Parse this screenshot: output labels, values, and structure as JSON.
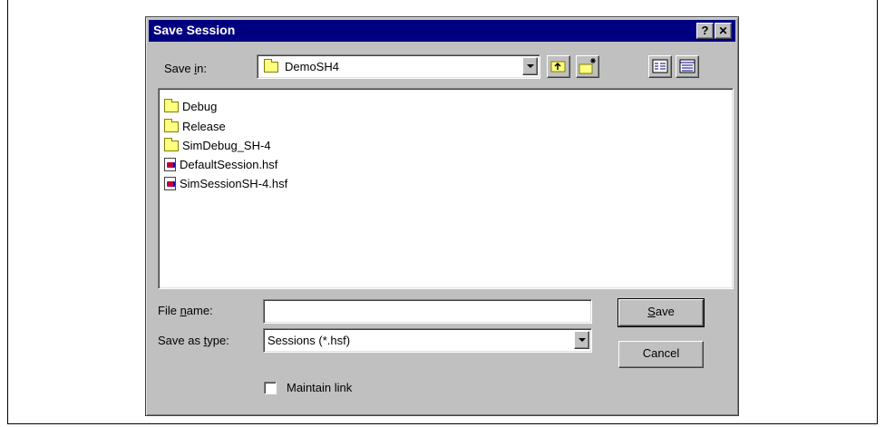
{
  "dialog": {
    "title": "Save Session",
    "help_button": "?",
    "close_button": "✕"
  },
  "save_in": {
    "label_pre": "Save ",
    "label_key": "i",
    "label_post": "n:",
    "value": "DemoSH4"
  },
  "toolbar": {
    "up_folder": "up-one-level",
    "new_folder": "create-new-folder",
    "list_view": "list-view",
    "details_view": "details-view"
  },
  "files": [
    {
      "name": "Debug",
      "type": "folder"
    },
    {
      "name": "Release",
      "type": "folder"
    },
    {
      "name": "SimDebug_SH-4",
      "type": "folder"
    },
    {
      "name": "DefaultSession.hsf",
      "type": "file"
    },
    {
      "name": "SimSessionSH-4.hsf",
      "type": "file"
    }
  ],
  "filename": {
    "label_pre": "File ",
    "label_key": "n",
    "label_post": "ame:",
    "value": ""
  },
  "savetype": {
    "label_pre": "Save as ",
    "label_key": "t",
    "label_post": "ype:",
    "value": "Sessions (*.hsf)"
  },
  "buttons": {
    "save_key": "S",
    "save_rest": "ave",
    "cancel": "Cancel"
  },
  "maintain_link": {
    "label": "Maintain link",
    "checked": false
  }
}
